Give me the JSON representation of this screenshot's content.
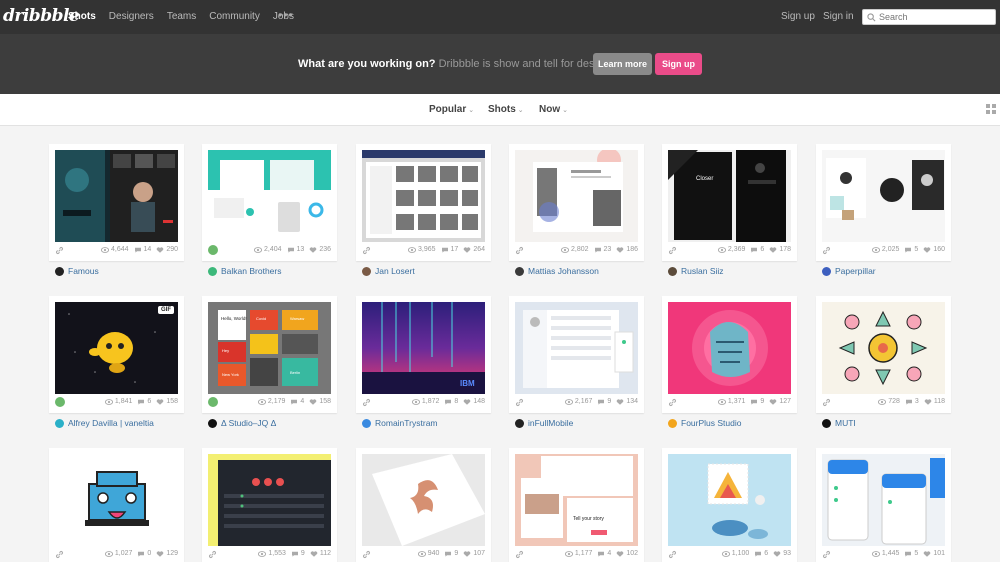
{
  "nav": {
    "logo": "dribbble",
    "links": [
      "Shots",
      "Designers",
      "Teams",
      "Community",
      "Jobs"
    ],
    "more": "•••",
    "sign_up": "Sign up",
    "sign_in": "Sign in",
    "search_placeholder": "Search"
  },
  "banner": {
    "headline": "What are you working on?",
    "text": " Dribbble is show and tell for designers.",
    "learn_more": "Learn more",
    "sign_up": "Sign up"
  },
  "filters": {
    "popular": "Popular",
    "shots": "Shots",
    "now": "Now",
    "caret": "⌄"
  },
  "shots": [
    {
      "views": "4,644",
      "comments": "14",
      "likes": "290",
      "author": "Famous",
      "rebound": false
    },
    {
      "views": "2,404",
      "comments": "13",
      "likes": "236",
      "author": "Balkan Brothers",
      "rebound": true
    },
    {
      "views": "3,965",
      "comments": "17",
      "likes": "264",
      "author": "Jan Losert",
      "rebound": false
    },
    {
      "views": "2,802",
      "comments": "23",
      "likes": "186",
      "author": "Mattias Johansson",
      "rebound": false
    },
    {
      "views": "2,369",
      "comments": "6",
      "likes": "178",
      "author": "Ruslan Siiz",
      "rebound": false
    },
    {
      "views": "2,025",
      "comments": "5",
      "likes": "160",
      "author": "Paperpillar",
      "rebound": false
    },
    {
      "views": "1,841",
      "comments": "6",
      "likes": "158",
      "author": "Alfrey Davilla | vaneltia",
      "rebound": true
    },
    {
      "views": "2,179",
      "comments": "4",
      "likes": "158",
      "author": "Δ Studio–JQ Δ",
      "rebound": true
    },
    {
      "views": "1,872",
      "comments": "8",
      "likes": "148",
      "author": "RomainTrystram",
      "rebound": false
    },
    {
      "views": "2,167",
      "comments": "9",
      "likes": "134",
      "author": "inFullMobile",
      "rebound": false
    },
    {
      "views": "1,371",
      "comments": "9",
      "likes": "127",
      "author": "FourPlus Studio",
      "rebound": false
    },
    {
      "views": "728",
      "comments": "3",
      "likes": "118",
      "author": "MUTI",
      "rebound": false
    },
    {
      "views": "1,027",
      "comments": "0",
      "likes": "129",
      "author": "",
      "rebound": false
    },
    {
      "views": "1,553",
      "comments": "9",
      "likes": "112",
      "author": "",
      "rebound": false
    },
    {
      "views": "940",
      "comments": "9",
      "likes": "107",
      "author": "",
      "rebound": false
    },
    {
      "views": "1,177",
      "comments": "4",
      "likes": "102",
      "author": "",
      "rebound": false
    },
    {
      "views": "1,100",
      "comments": "6",
      "likes": "93",
      "author": "",
      "rebound": false
    },
    {
      "views": "1,445",
      "comments": "5",
      "likes": "101",
      "author": "",
      "rebound": false
    }
  ],
  "thumb_text": {
    "gif": "GIF",
    "closer": "Closer",
    "ibm": "IBM",
    "hello_world": "Hello, World!",
    "cities": [
      "Covid",
      "Warsaw",
      "Hey",
      "New York",
      "Berlin"
    ],
    "tell_story": "Tell your story"
  },
  "colors": {
    "accent": "#ea4c89",
    "link": "#3a6e9f",
    "nav_bg": "#333333",
    "banner_bg": "#3d3d3d"
  }
}
